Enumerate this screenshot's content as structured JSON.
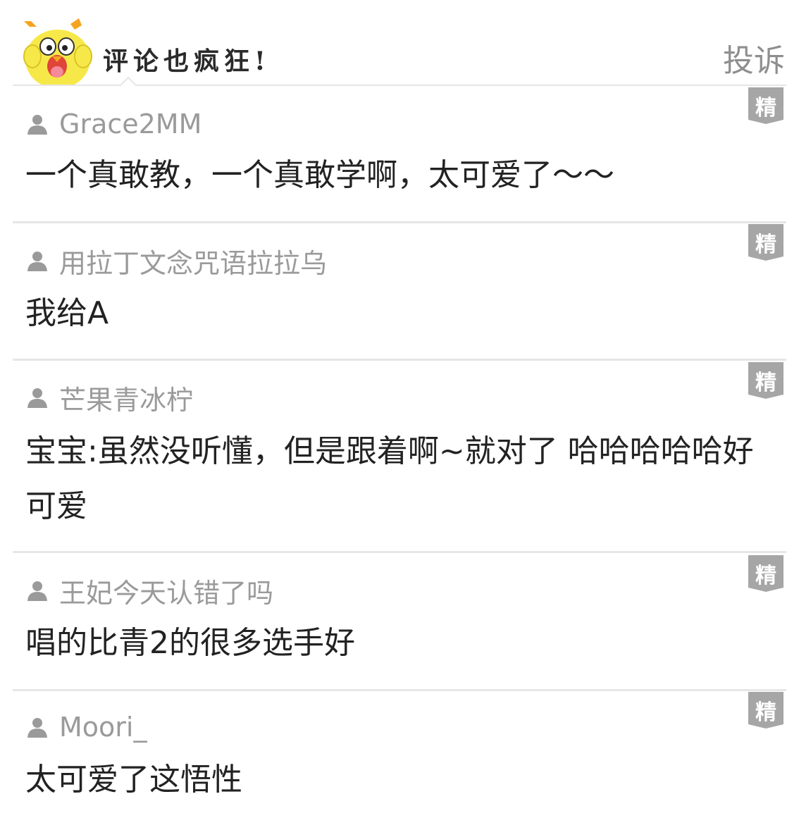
{
  "header": {
    "title": "评论也疯狂!",
    "report_label": "投诉"
  },
  "featured_badge": "精",
  "comments": [
    {
      "username": "Grace2MM",
      "text": "一个真敢教，一个真敢学啊，太可爱了～～"
    },
    {
      "username": "用拉丁文念咒语拉拉乌",
      "text": "我给A"
    },
    {
      "username": "芒果青冰柠",
      "text": "宝宝:虽然没听懂，但是跟着啊~就对了 哈哈哈哈哈好可爱"
    },
    {
      "username": "王妃今天认错了吗",
      "text": "唱的比青2的很多选手好"
    },
    {
      "username": "Moori_",
      "text": "太可爱了这悟性"
    }
  ],
  "colors": {
    "mascot_yellow": "#f7e84a",
    "badge_gray": "#a6a6a6",
    "separator": "#e6e6e6",
    "username_gray": "#9a9a9a",
    "text_dark": "#222222"
  },
  "icons": {
    "mascot": "yellow-chick-mascot-icon",
    "user": "user-silhouette-icon",
    "badge": "featured-ribbon-icon"
  }
}
